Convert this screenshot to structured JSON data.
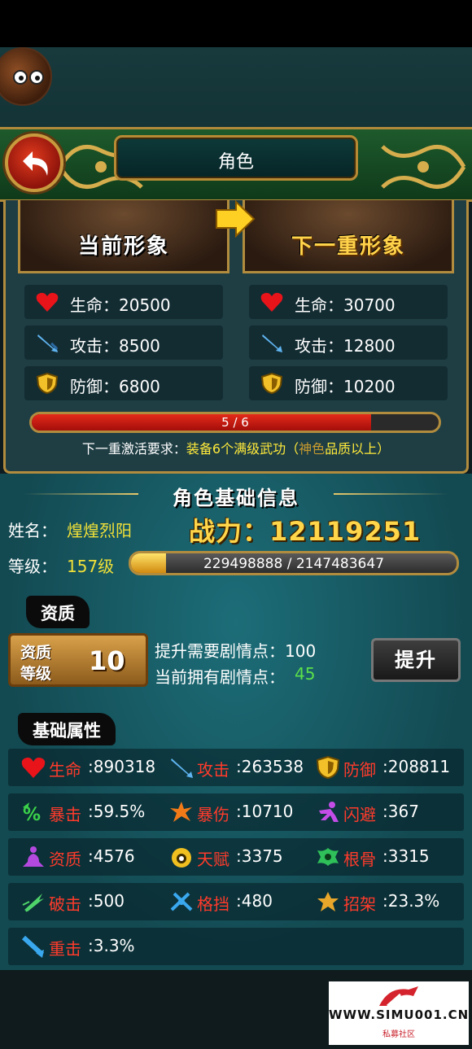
{
  "title": "角色",
  "images": {
    "current_label": "当前形象",
    "next_label": "下一重形象"
  },
  "current_stats": [
    {
      "icon": "heart-icon",
      "label": "生命：20500"
    },
    {
      "icon": "sword-icon",
      "label": "攻击：8500"
    },
    {
      "icon": "shield-icon",
      "label": "防御：6800"
    }
  ],
  "next_stats": [
    {
      "icon": "heart-icon",
      "label": "生命：30700"
    },
    {
      "icon": "sword-icon",
      "label": "攻击：12800"
    },
    {
      "icon": "shield-icon",
      "label": "防御：10200"
    }
  ],
  "progress": {
    "text": "5 / 6",
    "fraction": 0.8333
  },
  "requirement": {
    "prefix": "下一重激活要求：",
    "main": "装备6个满级武功（",
    "quality": "神色",
    "suffix": "品质以上）"
  },
  "basic_info": {
    "title": "角色基础信息",
    "name_label": "姓名：",
    "name_value": "煌煌烈阳",
    "power_text": "战力：12119251",
    "level_label": "等级：",
    "level_value": "157级",
    "exp_text": "229498888 / 2147483647",
    "exp_fraction": 0.1069
  },
  "aptitude": {
    "tag": "资质",
    "box_line1": "资质",
    "box_line2": "等级",
    "box_value": "10",
    "need_text": "提升需要剧情点：100",
    "have_label": "当前拥有剧情点：",
    "have_value": "45",
    "upgrade_button": "提升"
  },
  "attributes": {
    "tag": "基础属性",
    "rows": [
      [
        {
          "icon": "heart-icon",
          "name": "生命",
          "value": ":890318"
        },
        {
          "icon": "sword-icon",
          "name": "攻击",
          "value": ":263538"
        },
        {
          "icon": "shield-icon",
          "name": "防御",
          "value": ":208811"
        }
      ],
      [
        {
          "icon": "crit-icon",
          "name": "暴击",
          "value": ":59.5%"
        },
        {
          "icon": "crit-damage-icon",
          "name": "暴伤",
          "value": ":10710"
        },
        {
          "icon": "dodge-icon",
          "name": "闪避",
          "value": ":367"
        }
      ],
      [
        {
          "icon": "meditation-icon",
          "name": "资质",
          "value": ":4576"
        },
        {
          "icon": "talent-icon",
          "name": "天赋",
          "value": ":3375"
        },
        {
          "icon": "bone-icon",
          "name": "根骨",
          "value": ":3315"
        }
      ],
      [
        {
          "icon": "break-icon",
          "name": "破击",
          "value": ":500"
        },
        {
          "icon": "block-icon",
          "name": "格挡",
          "value": ":480"
        },
        {
          "icon": "parry-icon",
          "name": "招架",
          "value": ":23.3%"
        }
      ],
      [
        {
          "icon": "heavy-strike-icon",
          "name": "重击",
          "value": ":3.3%"
        }
      ]
    ]
  },
  "watermark": {
    "text": "WWW.SIMU001.CN",
    "sub": "私募社区"
  },
  "colors": {
    "attr_name": "#ff3b2b",
    "yellow_value": "#f0e038",
    "green_value": "#5be04a",
    "gold_border": "#b28c3e"
  }
}
